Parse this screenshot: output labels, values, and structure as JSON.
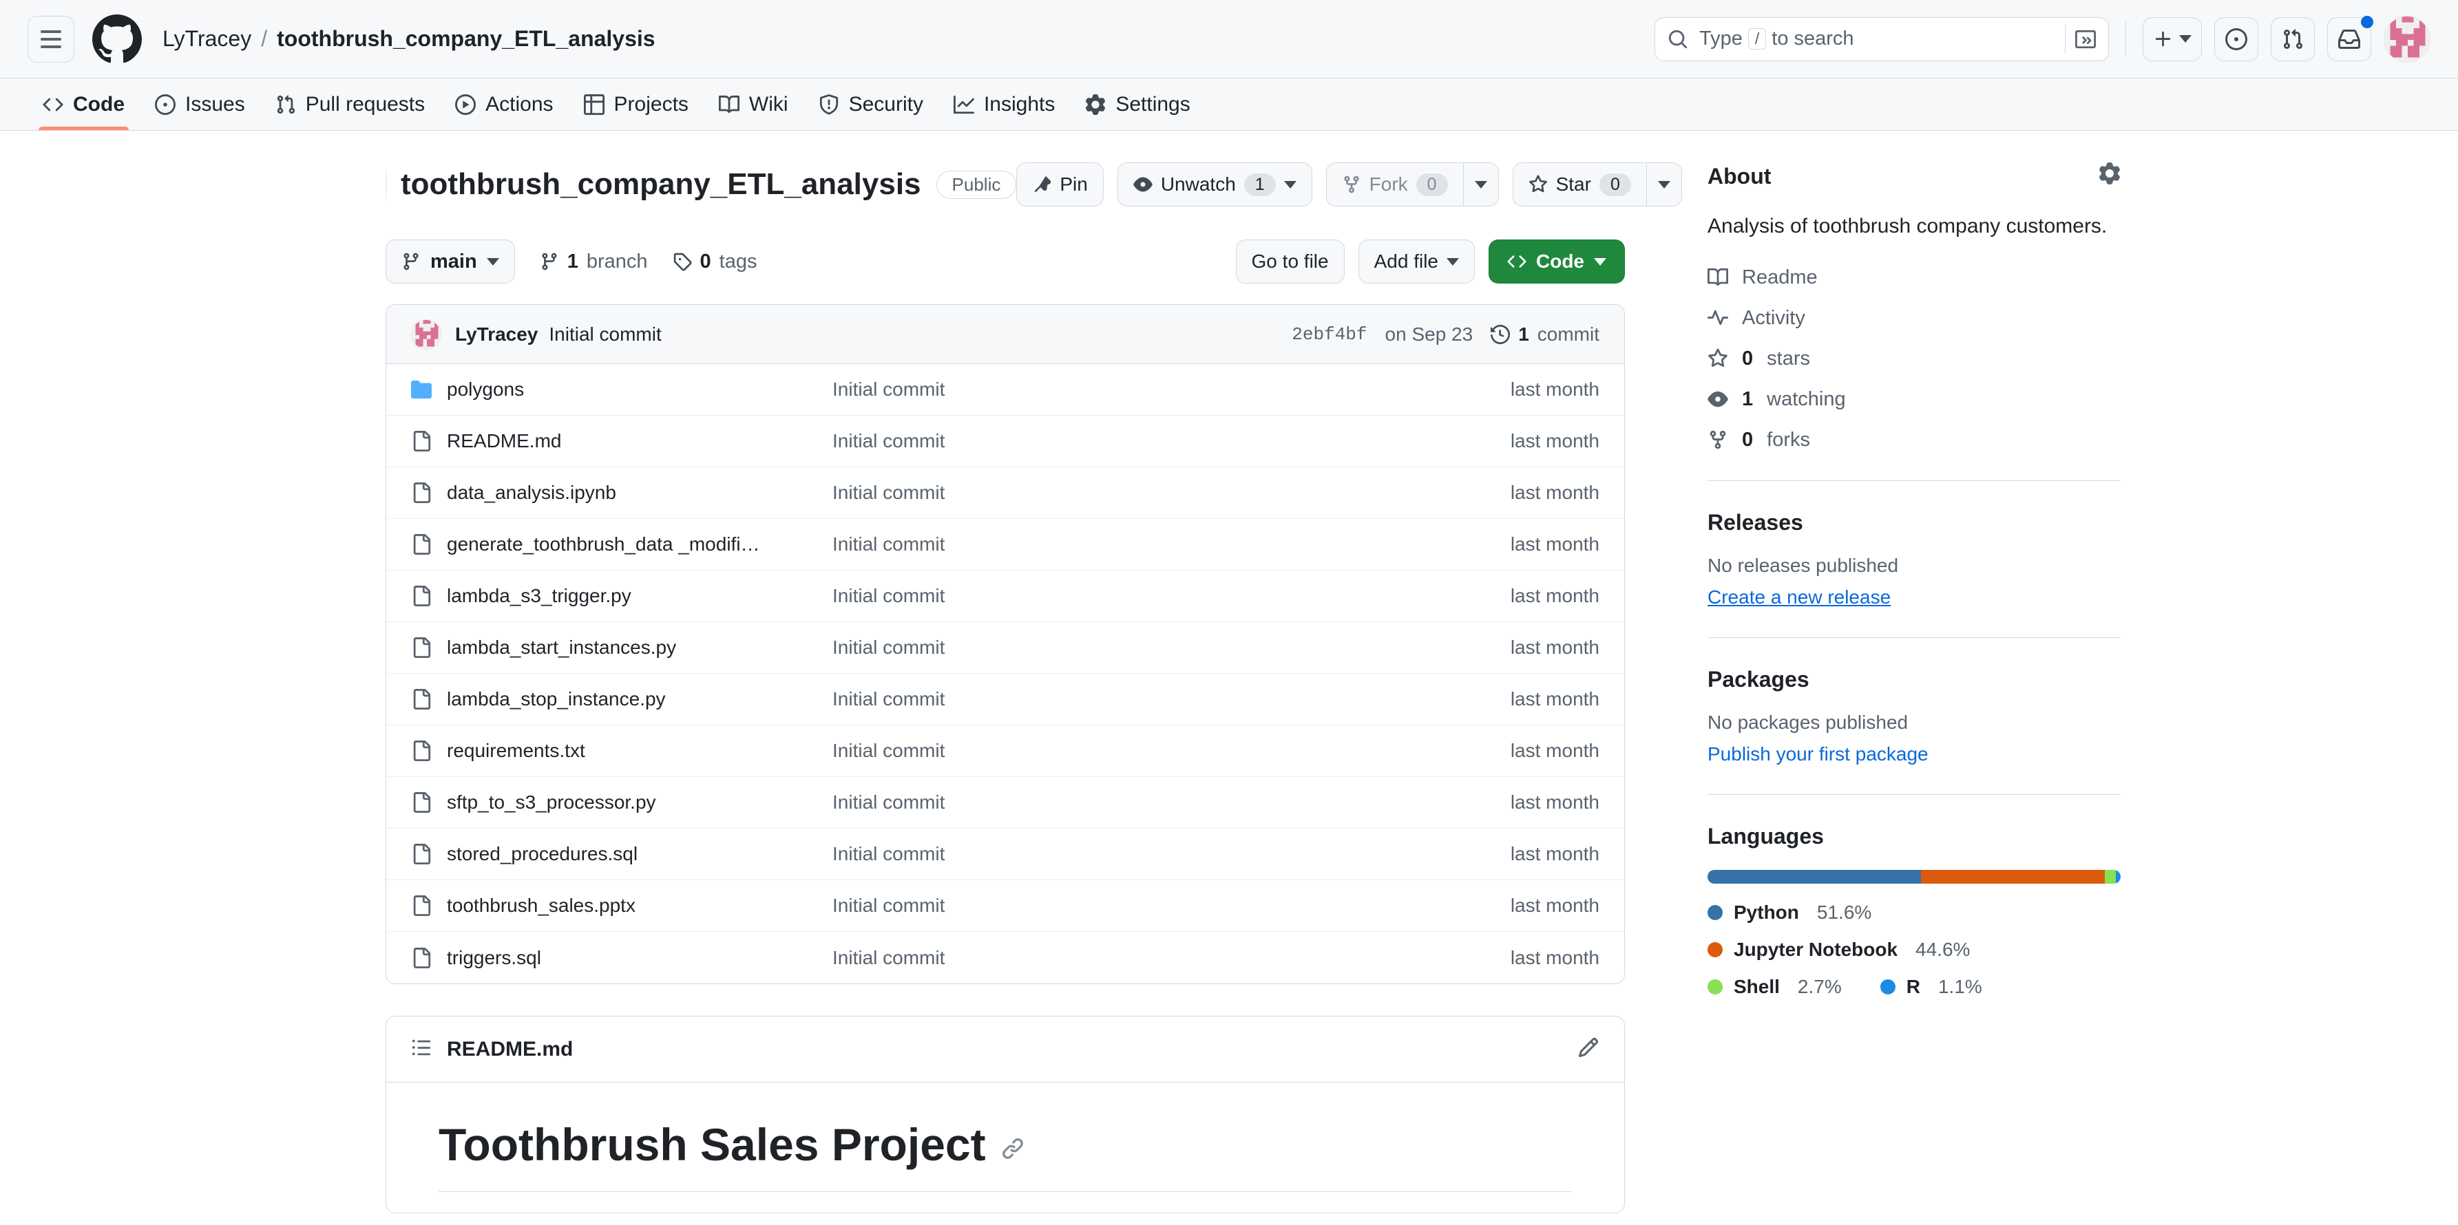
{
  "header": {
    "menu_icon": "hamburger-icon",
    "logo_icon": "github-logo-icon",
    "owner": "LyTracey",
    "separator": "/",
    "repo": "toothbrush_company_ETL_analysis",
    "search": {
      "placeholder_prefix": "Type",
      "slash_key": "/",
      "placeholder_suffix": "to search",
      "icon": "search-icon",
      "command_icon": "terminal-icon"
    },
    "actions": [
      {
        "name": "create-new-button",
        "icon": "plus-icon",
        "has_caret": true
      },
      {
        "name": "issues-button",
        "icon": "issue-opened-icon",
        "has_caret": false
      },
      {
        "name": "pull-requests-button",
        "icon": "git-pull-request-icon",
        "has_caret": false
      },
      {
        "name": "notifications-button",
        "icon": "inbox-icon",
        "has_caret": false,
        "badge": true
      }
    ],
    "avatar": "user-avatar"
  },
  "nav": {
    "tabs": [
      {
        "label": "Code",
        "icon": "code-icon",
        "active": true
      },
      {
        "label": "Issues",
        "icon": "issue-opened-icon",
        "active": false
      },
      {
        "label": "Pull requests",
        "icon": "git-pull-request-icon",
        "active": false
      },
      {
        "label": "Actions",
        "icon": "play-icon",
        "active": false
      },
      {
        "label": "Projects",
        "icon": "table-icon",
        "active": false
      },
      {
        "label": "Wiki",
        "icon": "book-icon",
        "active": false
      },
      {
        "label": "Security",
        "icon": "shield-icon",
        "active": false
      },
      {
        "label": "Insights",
        "icon": "graph-icon",
        "active": false
      },
      {
        "label": "Settings",
        "icon": "gear-icon",
        "active": false
      }
    ]
  },
  "repo": {
    "name": "toothbrush_company_ETL_analysis",
    "visibility": "Public",
    "actions": {
      "pin": "Pin",
      "watch": "Unwatch",
      "watch_count": "1",
      "fork": "Fork",
      "fork_count": "0",
      "star": "Star",
      "star_count": "0"
    }
  },
  "toolbar": {
    "branch": "main",
    "branch_count": "1",
    "branch_label": "branch",
    "tag_count": "0",
    "tag_label": "tags",
    "go_to_file": "Go to file",
    "add_file": "Add file",
    "code": "Code"
  },
  "commit_header": {
    "author": "LyTracey",
    "message": "Initial commit",
    "sha": "2ebf4bf",
    "date": "on Sep 23",
    "count": "1",
    "count_label": "commit"
  },
  "files": [
    {
      "name": "polygons",
      "type": "folder",
      "message": "Initial commit",
      "age": "last month"
    },
    {
      "name": "README.md",
      "type": "file",
      "message": "Initial commit",
      "age": "last month"
    },
    {
      "name": "data_analysis.ipynb",
      "type": "file",
      "message": "Initial commit",
      "age": "last month"
    },
    {
      "name": "generate_toothbrush_data _modifi…",
      "type": "file",
      "message": "Initial commit",
      "age": "last month"
    },
    {
      "name": "lambda_s3_trigger.py",
      "type": "file",
      "message": "Initial commit",
      "age": "last month"
    },
    {
      "name": "lambda_start_instances.py",
      "type": "file",
      "message": "Initial commit",
      "age": "last month"
    },
    {
      "name": "lambda_stop_instance.py",
      "type": "file",
      "message": "Initial commit",
      "age": "last month"
    },
    {
      "name": "requirements.txt",
      "type": "file",
      "message": "Initial commit",
      "age": "last month"
    },
    {
      "name": "sftp_to_s3_processor.py",
      "type": "file",
      "message": "Initial commit",
      "age": "last month"
    },
    {
      "name": "stored_procedures.sql",
      "type": "file",
      "message": "Initial commit",
      "age": "last month"
    },
    {
      "name": "toothbrush_sales.pptx",
      "type": "file",
      "message": "Initial commit",
      "age": "last month"
    },
    {
      "name": "triggers.sql",
      "type": "file",
      "message": "Initial commit",
      "age": "last month"
    }
  ],
  "readme": {
    "filename": "README.md",
    "heading": "Toothbrush Sales Project",
    "anchor": "🔗",
    "list_icon": "list-unordered-icon",
    "edit_icon": "pencil-icon"
  },
  "sidebar": {
    "about": {
      "title": "About",
      "gear_icon": "gear-icon",
      "description": "Analysis of toothbrush company customers.",
      "items": [
        {
          "label": "Readme",
          "icon": "book-icon",
          "bold": ""
        },
        {
          "label": "Activity",
          "icon": "pulse-icon",
          "bold": ""
        },
        {
          "label": "stars",
          "icon": "star-icon",
          "bold": "0"
        },
        {
          "label": "watching",
          "icon": "eye-icon",
          "bold": "1"
        },
        {
          "label": "forks",
          "icon": "repo-forked-icon",
          "bold": "0"
        }
      ]
    },
    "releases": {
      "title": "Releases",
      "empty": "No releases published",
      "link": "Create a new release"
    },
    "packages": {
      "title": "Packages",
      "empty": "No packages published",
      "link": "Publish your first package"
    },
    "languages": {
      "title": "Languages",
      "items": [
        {
          "name": "Python",
          "pct": "51.6%",
          "value": 51.6,
          "color": "#3572A5"
        },
        {
          "name": "Jupyter Notebook",
          "pct": "44.6%",
          "value": 44.6,
          "color": "#DA5B0B"
        },
        {
          "name": "Shell",
          "pct": "2.7%",
          "value": 2.7,
          "color": "#89E051"
        },
        {
          "name": "R",
          "pct": "1.1%",
          "value": 1.1,
          "color": "#198CE7"
        }
      ]
    }
  },
  "colors": {
    "accent_green": "#1f883d",
    "link_blue": "#0969da",
    "active_tab": "#fd8c73",
    "folder_blue": "#54aeff"
  }
}
